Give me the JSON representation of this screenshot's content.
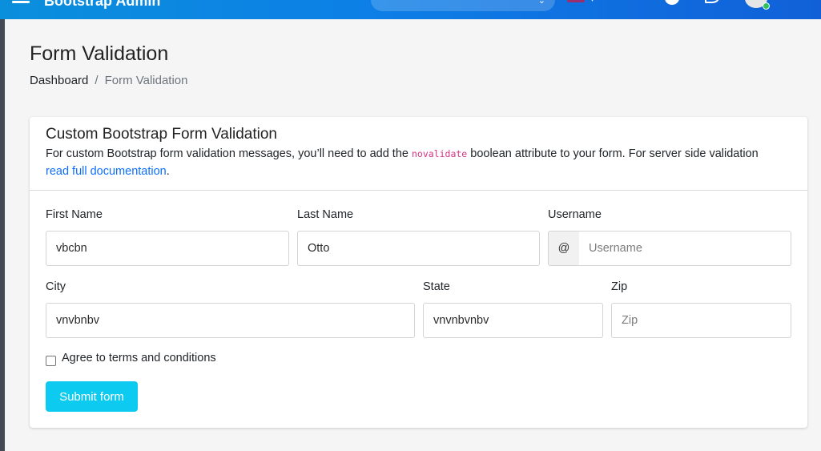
{
  "app": {
    "title": "Bootstrap Admin"
  },
  "header": {
    "menu_icon": "hamburger-icon",
    "search_icon": "chevron-down-icon",
    "settings_icon": "gear-icon",
    "chat_icon": "chat-icon",
    "accent_gradient": [
      "#0a8fdc",
      "#1160d8"
    ]
  },
  "page": {
    "title": "Form Validation",
    "breadcrumb": {
      "home": "Dashboard",
      "separator": "/",
      "current": "Form Validation"
    }
  },
  "card": {
    "title": "Custom Bootstrap Form Validation",
    "desc_part1": "For custom Bootstrap form validation messages, you’ll need to add the ",
    "desc_code": "novalidate",
    "desc_part2": " boolean attribute to your form. For server side validation ",
    "desc_link": "read full documentation",
    "desc_end": "."
  },
  "form": {
    "first_name": {
      "label": "First Name",
      "value": "vbcbn"
    },
    "last_name": {
      "label": "Last Name",
      "value": "Otto"
    },
    "username": {
      "label": "Username",
      "prepend": "@",
      "value": "",
      "placeholder": "Username"
    },
    "city": {
      "label": "City",
      "value": "vnvbnbv"
    },
    "state": {
      "label": "State",
      "value": "vnvnbvnbv"
    },
    "zip": {
      "label": "Zip",
      "value": "",
      "placeholder": "Zip"
    },
    "terms": {
      "label": "Agree to terms and conditions",
      "checked": false
    },
    "submit_label": "Submit form",
    "submit_color": "#0dcaf0"
  }
}
